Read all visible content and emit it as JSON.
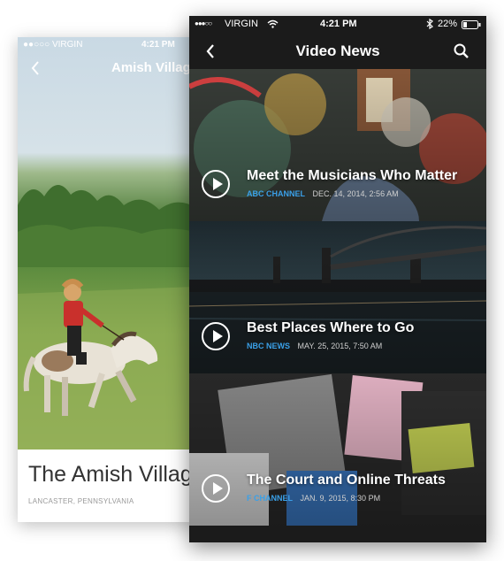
{
  "back_screen": {
    "status": {
      "carrier": "●●○○○ VIRGIN",
      "time": "4:21 PM"
    },
    "header": {
      "title": "Amish Village"
    },
    "caption": {
      "title": "The Amish Village",
      "location": "LANCASTER, PENNSYLVANIA"
    }
  },
  "front_screen": {
    "status": {
      "signal": "●●●○○",
      "carrier": "VIRGIN",
      "time": "4:21 PM",
      "battery": "22%"
    },
    "header": {
      "title": "Video News"
    },
    "videos": [
      {
        "title": "Meet the Musicians Who Matter",
        "channel": "ABC CHANNEL",
        "date": "DEC. 14, 2014, 2:56 AM"
      },
      {
        "title": "Best Places Where to Go",
        "channel": "NBC NEWS",
        "date": "MAY. 25, 2015, 7:50 AM"
      },
      {
        "title": "The Court and Online Threats",
        "channel": "F CHANNEL",
        "date": "JAN. 9, 2015, 8:30 PM"
      }
    ]
  },
  "colors": {
    "accent": "#3aa0e8",
    "header_bg": "#1b1b1b"
  },
  "icons": [
    "back-chevron-icon",
    "search-icon",
    "wifi-icon",
    "bluetooth-icon",
    "battery-icon",
    "play-icon"
  ]
}
